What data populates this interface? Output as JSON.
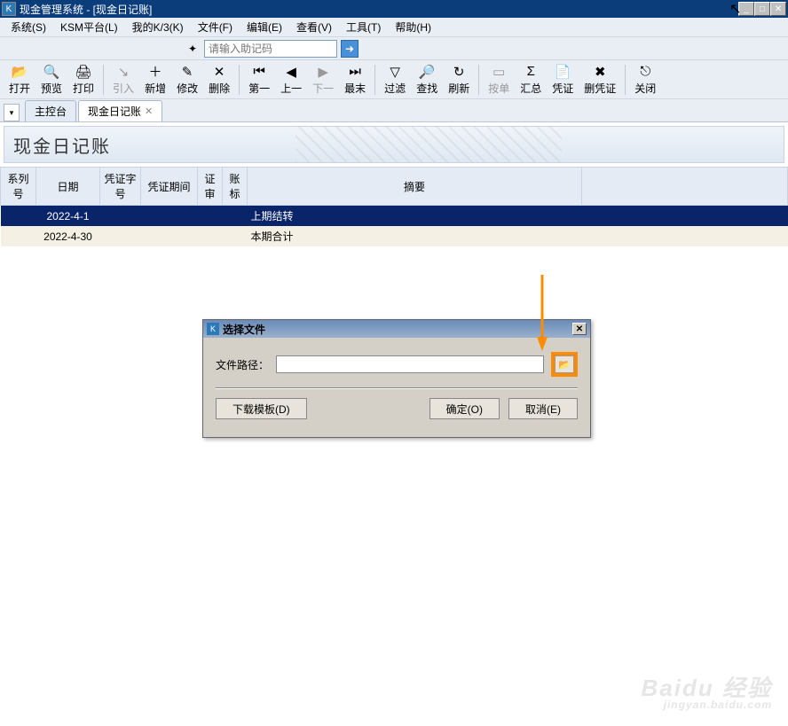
{
  "title": "现金管理系统 - [现金日记账]",
  "menu": [
    "系统(S)",
    "KSM平台(L)",
    "我的K/3(K)",
    "文件(F)",
    "编辑(E)",
    "查看(V)",
    "工具(T)",
    "帮助(H)"
  ],
  "helper_placeholder": "请输入助记码",
  "toolbar": [
    {
      "label": "打开",
      "icon": "📂"
    },
    {
      "label": "预览",
      "icon": "🔍"
    },
    {
      "label": "打印",
      "icon": "🖨"
    },
    {
      "sep": true
    },
    {
      "label": "引入",
      "icon": "↘",
      "disabled": true
    },
    {
      "label": "新增",
      "icon": "＋"
    },
    {
      "label": "修改",
      "icon": "✎"
    },
    {
      "label": "删除",
      "icon": "✕"
    },
    {
      "sep": true
    },
    {
      "label": "第一",
      "icon": "⏮"
    },
    {
      "label": "上一",
      "icon": "◀"
    },
    {
      "label": "下一",
      "icon": "▶",
      "disabled": true
    },
    {
      "label": "最末",
      "icon": "⏭"
    },
    {
      "sep": true
    },
    {
      "label": "过滤",
      "icon": "▽"
    },
    {
      "label": "查找",
      "icon": "🔎"
    },
    {
      "label": "刷新",
      "icon": "↻"
    },
    {
      "sep": true
    },
    {
      "label": "按单",
      "icon": "▭",
      "disabled": true
    },
    {
      "label": "汇总",
      "icon": "Σ"
    },
    {
      "label": "凭证",
      "icon": "📄"
    },
    {
      "label": "删凭证",
      "icon": "✖"
    },
    {
      "sep": true
    },
    {
      "label": "关闭",
      "icon": "⎋"
    }
  ],
  "tabs": {
    "main": "主控台",
    "active": "现金日记账"
  },
  "page_title": "现金日记账",
  "columns": [
    "系列号",
    "日期",
    "凭证字号",
    "凭证期间",
    "证审",
    "账标",
    "摘要"
  ],
  "rows": [
    {
      "date": "2022-4-1",
      "summary": "上期结转",
      "selected": true
    },
    {
      "date": "2022-4-30",
      "summary": "本期合计",
      "alt": true
    }
  ],
  "dialog": {
    "title": "选择文件",
    "path_label": "文件路径：",
    "path_value": "",
    "download_btn": "下载模板(D)",
    "ok_btn": "确定(O)",
    "cancel_btn": "取消(E)"
  },
  "watermark": {
    "main": "Baidu 经验",
    "sub": "jingyan.baidu.com"
  }
}
